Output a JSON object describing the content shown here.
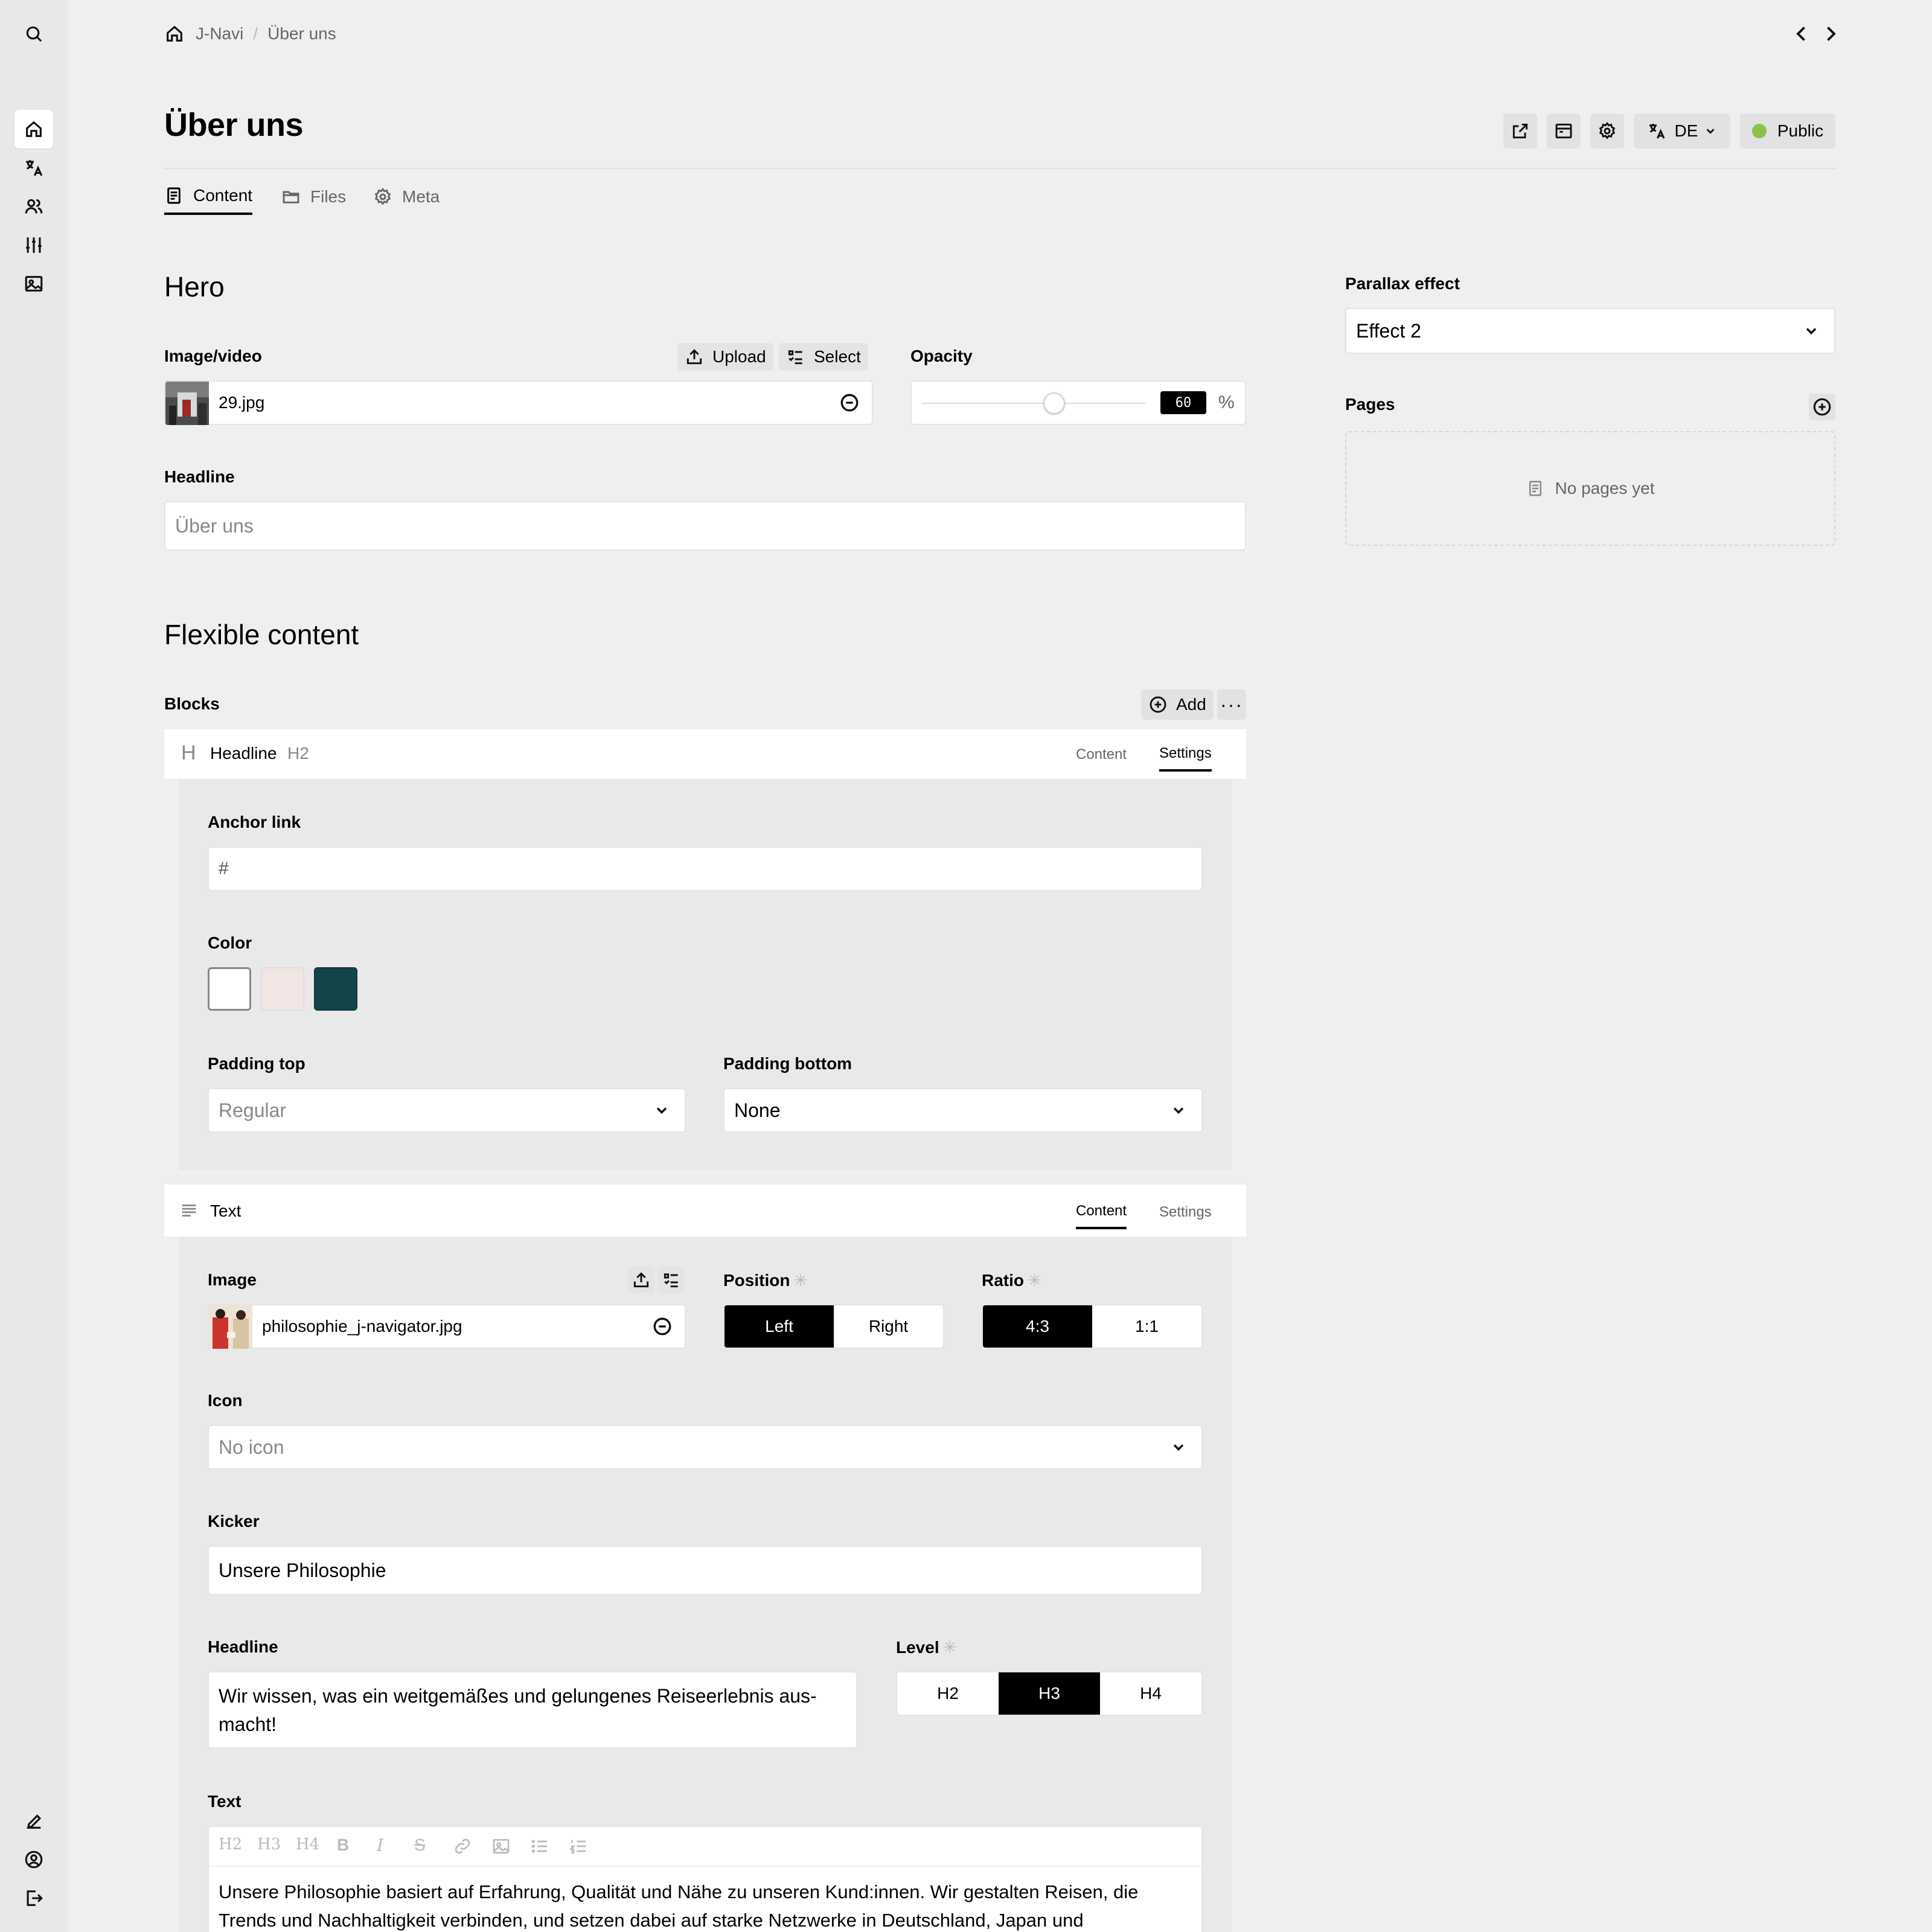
{
  "breadcrumb": {
    "site": "J-Navi",
    "page": "Über uns"
  },
  "page": {
    "title": "Über uns"
  },
  "header": {
    "language": "DE",
    "status": "Public",
    "status_color": "#8bc34a"
  },
  "tabs": [
    {
      "label": "Content",
      "icon": "page-icon"
    },
    {
      "label": "Files",
      "icon": "folder-icon"
    },
    {
      "label": "Meta",
      "icon": "gear-icon"
    }
  ],
  "hero": {
    "section_title": "Hero",
    "image_label": "Image/video",
    "upload_label": "Upload",
    "select_label": "Select",
    "image_file": "29.jpg",
    "opacity_label": "Opacity",
    "opacity_value": "60",
    "opacity_unit": "%",
    "headline_label": "Headline",
    "headline_placeholder": "Über uns"
  },
  "sidebar": {
    "parallax_label": "Parallax effect",
    "parallax_value": "Effect 2",
    "pages_label": "Pages",
    "pages_empty": "No pages yet"
  },
  "flexible": {
    "section_title": "Flexible content",
    "blocks_label": "Blocks",
    "add_label": "Add"
  },
  "block_headline": {
    "type": "Headline",
    "level": "H2",
    "tab_content": "Content",
    "tab_settings": "Settings",
    "anchor_label": "Anchor link",
    "anchor_value": "#",
    "color_label": "Color",
    "colors": [
      "#ffffff",
      "#f1e6e3",
      "#12444a"
    ],
    "padding_top_label": "Padding top",
    "padding_top_value": "Regular",
    "padding_bottom_label": "Padding bottom",
    "padding_bottom_value": "None"
  },
  "block_text": {
    "type": "Text",
    "tab_content": "Content",
    "tab_settings": "Settings",
    "image_label": "Image",
    "image_file": "philosophie_j-navigator.jpg",
    "position_label": "Position",
    "position_options": [
      "Left",
      "Right"
    ],
    "position_selected": "Left",
    "ratio_label": "Ratio",
    "ratio_options": [
      "4:3",
      "1:1"
    ],
    "ratio_selected": "4:3",
    "icon_label": "Icon",
    "icon_value": "No icon",
    "kicker_label": "Kicker",
    "kicker_value": "Unsere Philosophie",
    "headline_label": "Headline",
    "headline_line1": "Wir wissen, was ein weitgemäßes und gelungenes Reiseerlebnis aus-",
    "headline_line2": "macht!",
    "level_label": "Level",
    "level_options": [
      "H2",
      "H3",
      "H4"
    ],
    "level_selected": "H3",
    "text_label": "Text",
    "toolbar": [
      "H2",
      "H3",
      "H4",
      "B",
      "I",
      "S",
      "link",
      "image",
      "ul",
      "ol"
    ],
    "text_line1": "Unsere Philosophie basiert auf Erfahrung, Qualität und Nähe zu unseren Kund:innen. Wir gestalten Reisen, die",
    "text_line2": "Trends und Nachhaltigkeit verbinden, und setzen dabei auf starke Netzwerke in Deutschland, Japan und"
  }
}
